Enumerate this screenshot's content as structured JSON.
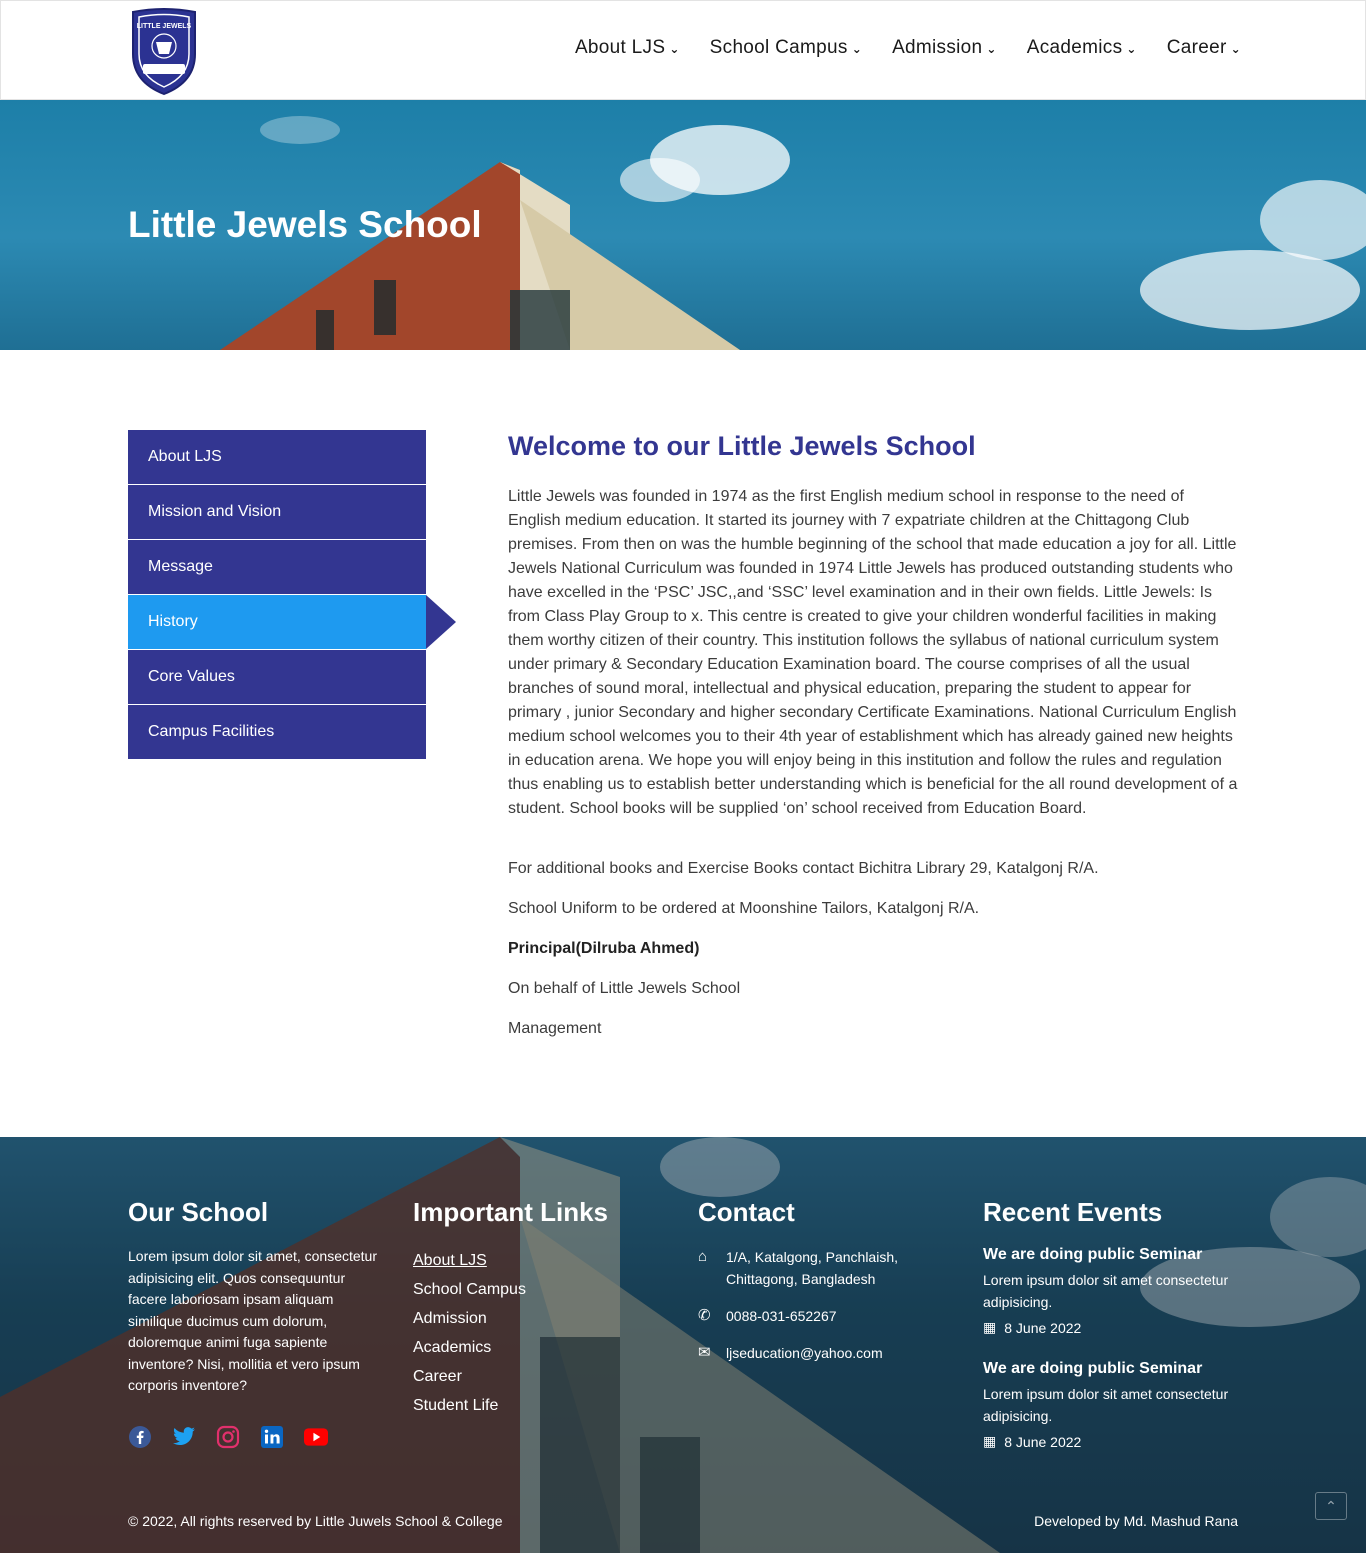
{
  "header": {
    "logo_text": "LITTLE JEWELS",
    "nav": [
      {
        "label": "About LJS"
      },
      {
        "label": "School Campus"
      },
      {
        "label": "Admission"
      },
      {
        "label": "Academics"
      },
      {
        "label": "Career"
      }
    ]
  },
  "hero": {
    "title": "Little Jewels School"
  },
  "sidebar": {
    "items": [
      {
        "label": "About LJS"
      },
      {
        "label": "Mission and Vision"
      },
      {
        "label": "Message"
      },
      {
        "label": "History",
        "active": true
      },
      {
        "label": "Core Values"
      },
      {
        "label": "Campus Facilities"
      }
    ]
  },
  "main": {
    "heading": "Welcome to our Little Jewels School",
    "body": "Little Jewels was founded in 1974 as the first English medium school in response to the need of English medium education. It started its journey with 7 expatriate children at the Chittagong Club premises. From then on was the humble beginning of the school that made education a joy for all. Little Jewels National Curriculum was founded in 1974 Little Jewels has produced outstanding students who have excelled in the ‘PSC’ JSC,,and ‘SSC’ level examination and in their own fields. Little Jewels: Is from Class Play Group to x. This centre is created to give your children wonderful facilities in making them worthy citizen of their country. This institution follows the syllabus of national curriculum system under primary & Secondary Education Examination board. The course comprises of all the usual branches of sound moral, intellectual and physical education, preparing the student to appear for primary , junior Secondary and higher secondary Certificate Examinations. National Curriculum English medium school welcomes you to their 4th year of establishment which has already gained new heights in education arena. We hope you will enjoy being in this institution and follow the rules and regulation thus enabling us to establish better understanding which is beneficial for the all round development of a student. School books will be supplied ‘on’ school received from Education Board.",
    "books": "For additional books and Exercise Books contact Bichitra Library 29, Katalgonj R/A.",
    "uniform": "School Uniform to be ordered at Moonshine Tailors, Katalgonj R/A.",
    "principal": "Principal(Dilruba Ahmed)",
    "behalf": "On behalf of Little Jewels School",
    "management": "Management"
  },
  "footer": {
    "our_school": {
      "title": "Our School",
      "text": "Lorem ipsum dolor sit amet, consectetur adipisicing elit. Quos consequuntur facere laboriosam ipsam aliquam similique ducimus cum dolorum, doloremque animi fuga sapiente inventore? Nisi, mollitia et vero ipsum corporis inventore?"
    },
    "links": {
      "title": "Important Links",
      "items": [
        "About LJS",
        "School Campus",
        "Admission",
        "Academics",
        "Career",
        "Student Life"
      ]
    },
    "contact": {
      "title": "Contact",
      "address": "1/A, Katalgong, Panchlaish, Chittagong, Bangladesh",
      "phone": "0088-031-652267",
      "email": "ljseducation@yahoo.com"
    },
    "events": {
      "title": "Recent Events",
      "items": [
        {
          "title": "We are doing public Seminar",
          "text": "Lorem ipsum dolor sit amet consectetur adipisicing.",
          "date": "8 June 2022"
        },
        {
          "title": "We are doing public Seminar",
          "text": "Lorem ipsum dolor sit amet consectetur adipisicing.",
          "date": "8 June 2022"
        }
      ]
    },
    "social": [
      {
        "icon": "facebook-icon",
        "color": "#3b5998"
      },
      {
        "icon": "twitter-icon",
        "color": "#1da1f2"
      },
      {
        "icon": "instagram-icon",
        "color": "#e1306c"
      },
      {
        "icon": "linkedin-icon",
        "color": "#0a66c2"
      },
      {
        "icon": "youtube-icon",
        "color": "#ff0000"
      }
    ],
    "copyright": "© 2022, All rights reserved by Little Juwels School & College",
    "developed": "Developed by Md. Mashud Rana"
  }
}
